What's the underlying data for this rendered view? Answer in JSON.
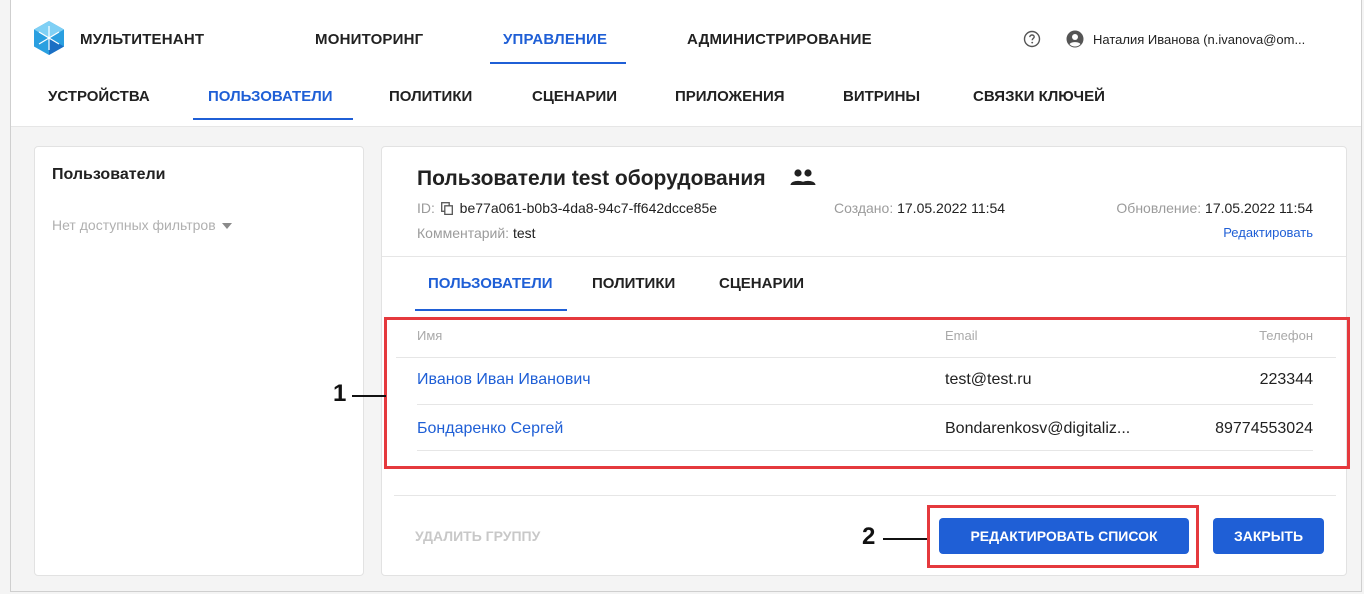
{
  "topnav": {
    "items": [
      "МУЛЬТИТЕНАНТ",
      "МОНИТОРИНГ",
      "УПРАВЛЕНИЕ",
      "АДМИНИСТРИРОВАНИЕ"
    ],
    "active": "УПРАВЛЕНИЕ",
    "user": "Наталия Иванова (n.ivanova@om..."
  },
  "subnav": {
    "items": [
      "УСТРОЙСТВА",
      "ПОЛЬЗОВАТЕЛИ",
      "ПОЛИТИКИ",
      "СЦЕНАРИИ",
      "ПРИЛОЖЕНИЯ",
      "ВИТРИНЫ",
      "СВЯЗКИ КЛЮЧЕЙ"
    ],
    "active": "ПОЛЬЗОВАТЕЛИ"
  },
  "sidebar": {
    "title": "Пользователи",
    "filter": "Нет доступных фильтров"
  },
  "group": {
    "title": "Пользователи test оборудования",
    "id_label": "ID:",
    "id_value": "be77a061-b0b3-4da8-94c7-ff642dcce85e",
    "comment_label": "Комментарий:",
    "comment_value": "test",
    "created_label": "Создано:",
    "created_value": "17.05.2022 11:54",
    "updated_label": "Обновление:",
    "updated_value": "17.05.2022 11:54",
    "edit_link": "Редактировать"
  },
  "tabs": [
    "ПОЛЬЗОВАТЕЛИ",
    "ПОЛИТИКИ",
    "СЦЕНАРИИ"
  ],
  "table": {
    "headers": [
      "Имя",
      "Email",
      "Телефон"
    ],
    "rows": [
      [
        "Иванов Иван Иванович",
        "test@test.ru",
        "223344"
      ],
      [
        "Бондаренко Сергей",
        "Bondarenkosv@digitaliz...",
        "89774553024"
      ]
    ]
  },
  "footer": {
    "delete_label": "УДАЛИТЬ ГРУППУ",
    "edit_list_label": "РЕДАКТИРОВАТЬ СПИСОК",
    "close_label": "ЗАКРЫТЬ"
  },
  "callouts": [
    "1",
    "2"
  ],
  "colors": {
    "accent": "#1f5fd6",
    "highlight": "#e5393d"
  }
}
